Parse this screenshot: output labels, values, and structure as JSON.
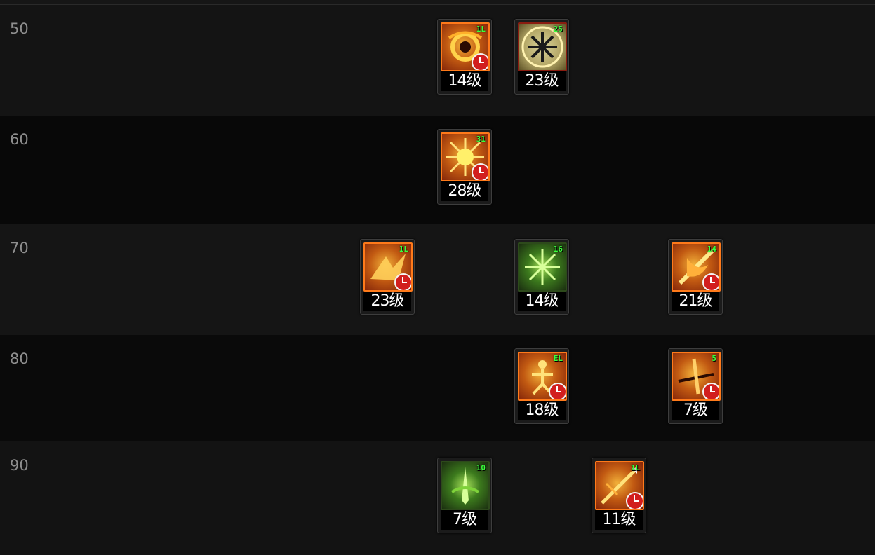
{
  "rows": [
    {
      "level": "50",
      "skills": [
        {
          "icon": "burning-vortex-icon",
          "tier": "orange",
          "badge": "1L",
          "level_text": "14级",
          "cooldown": true
        },
        {
          "icon": "snowflake-emblem-icon",
          "tier": "pale",
          "badge": "25",
          "level_text": "23级",
          "cooldown": false
        }
      ]
    },
    {
      "level": "60",
      "skills": [
        {
          "icon": "fire-burst-icon",
          "tier": "orange",
          "badge": "31",
          "level_text": "28级",
          "cooldown": true
        }
      ]
    },
    {
      "level": "70",
      "skills": [
        {
          "icon": "golden-beast-icon",
          "tier": "orange",
          "badge": "1L",
          "level_text": "23级",
          "cooldown": true
        },
        {
          "icon": "green-frost-icon",
          "tier": "green",
          "badge": "16",
          "level_text": "14级",
          "cooldown": false
        },
        {
          "icon": "flame-strike-icon",
          "tier": "orange",
          "badge": "14",
          "level_text": "21级",
          "cooldown": true
        }
      ]
    },
    {
      "level": "80",
      "skills": [
        {
          "icon": "dancing-figure-icon",
          "tier": "orange",
          "badge": "EL",
          "level_text": "18级",
          "cooldown": true
        },
        {
          "icon": "crimson-slash-icon",
          "tier": "orange",
          "badge": "5",
          "level_text": "7级",
          "cooldown": true
        }
      ]
    },
    {
      "level": "90",
      "skills": [
        {
          "icon": "green-blade-icon",
          "tier": "green",
          "badge": "10",
          "level_text": "7级",
          "cooldown": false
        },
        {
          "icon": "golden-spear-icon",
          "tier": "orange",
          "badge": "1L",
          "level_text": "11级",
          "cooldown": true
        }
      ]
    }
  ]
}
